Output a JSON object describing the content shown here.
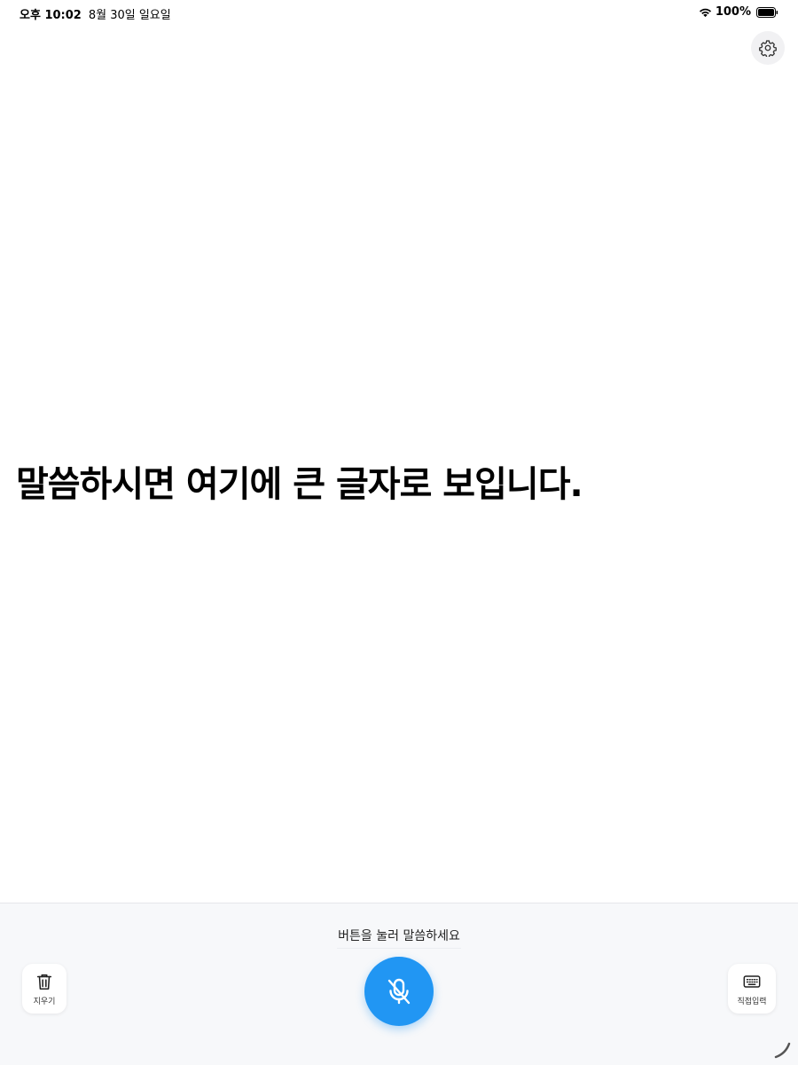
{
  "status_bar": {
    "time": "오후 10:02",
    "date": "8월 30일 일요일",
    "battery_percent": "100%",
    "battery_level": 1.0,
    "wifi_icon": "wifi-icon",
    "battery_icon": "battery-full-icon"
  },
  "header": {
    "settings_icon": "gear-icon"
  },
  "main": {
    "display_text": "말씀하시면 여기에 큰 글자로 보입니다."
  },
  "bottom": {
    "hint": "버튼을 눌러 말씀하세요",
    "clear_label": "지우기",
    "clear_icon": "trash-icon",
    "mic_icon": "mic-off-icon",
    "keyboard_label": "직접입력",
    "keyboard_icon": "keyboard-icon"
  },
  "colors": {
    "accent": "#2196f3",
    "panel_background": "#f7f8fa"
  }
}
